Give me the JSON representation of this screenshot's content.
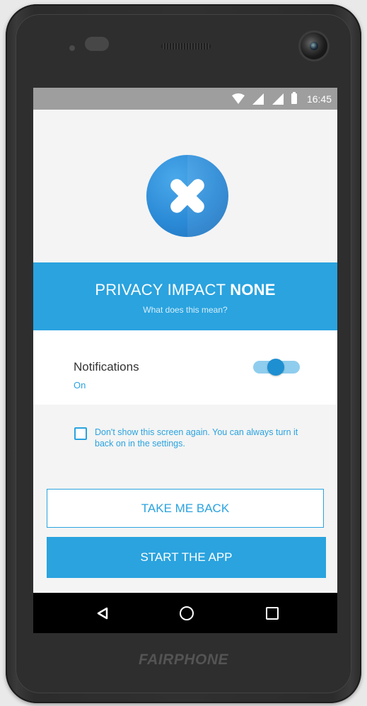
{
  "device": {
    "brand": "FAIRPHONE"
  },
  "status_bar": {
    "time": "16:45",
    "icons": [
      "wifi-icon",
      "signal-icon",
      "signal-icon",
      "battery-icon"
    ]
  },
  "hero": {
    "icon": "close-icon",
    "accent_color": "#2b8ad6"
  },
  "privacy_banner": {
    "title": "PRIVACY IMPACT",
    "level": "NONE",
    "subtitle": "What does this mean?",
    "color": "#2aa3df"
  },
  "notifications": {
    "label": "Notifications",
    "state": "On",
    "enabled": true
  },
  "dont_show": {
    "checked": false,
    "text": "Don't show this screen again. You can always turn it back on in the settings."
  },
  "buttons": {
    "back_label": "TAKE ME BACK",
    "start_label": "START THE APP"
  },
  "nav_bar": {
    "icons": [
      "back-icon",
      "home-icon",
      "recents-icon"
    ]
  }
}
